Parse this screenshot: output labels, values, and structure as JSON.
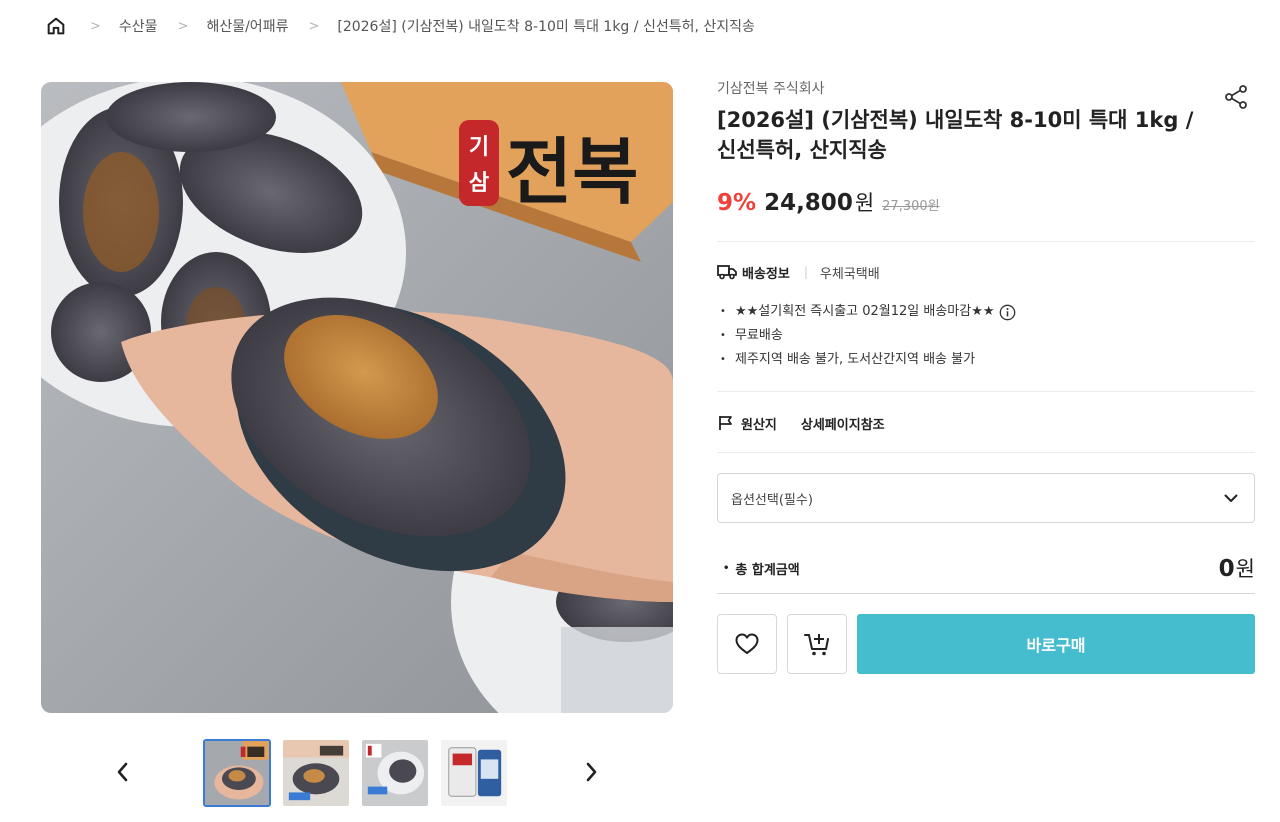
{
  "breadcrumb": {
    "items": [
      "수산물",
      "해산물/어패류",
      "[2026설] (기삼전복) 내일도착 8-10미 특대 1kg / 신선특허, 산지직송"
    ]
  },
  "main_image": {
    "logo_text_small_1": "기",
    "logo_text_small_2": "삼",
    "logo_text_large": "전복"
  },
  "product": {
    "seller": "기삼전복 주식회사",
    "title": "[2026설] (기삼전복) 내일도착 8-10미 특대 1kg / 신선특허, 산지직송",
    "discount": "9%",
    "price": "24,800",
    "currency": "원",
    "original_price": "27,300원"
  },
  "shipping": {
    "label": "배송정보",
    "carrier": "우체국택배",
    "notes": [
      "★★설기획전 즉시출고 02월12일 배송마감★★",
      "무료배송",
      "제주지역 배송 불가, 도서산간지역 배송 불가"
    ]
  },
  "origin": {
    "label": "원산지",
    "value": "상세페이지참조"
  },
  "option_select": {
    "placeholder": "옵션선택(필수)"
  },
  "total": {
    "label": "총 합계금액",
    "amount": "0",
    "currency": "원"
  },
  "actions": {
    "buy_label": "바로구매"
  },
  "thumbnails": {
    "count": 4,
    "active_index": 0
  },
  "colors": {
    "discount": "#f0413b",
    "buy_button": "#46bdcf",
    "active_thumb_border": "#3a7bd5"
  },
  "icons": [
    "home-icon",
    "share-icon",
    "truck-icon",
    "info-icon",
    "flag-icon",
    "chevron-down-icon",
    "heart-icon",
    "cart-add-icon",
    "chevron-left-icon",
    "chevron-right-icon"
  ]
}
